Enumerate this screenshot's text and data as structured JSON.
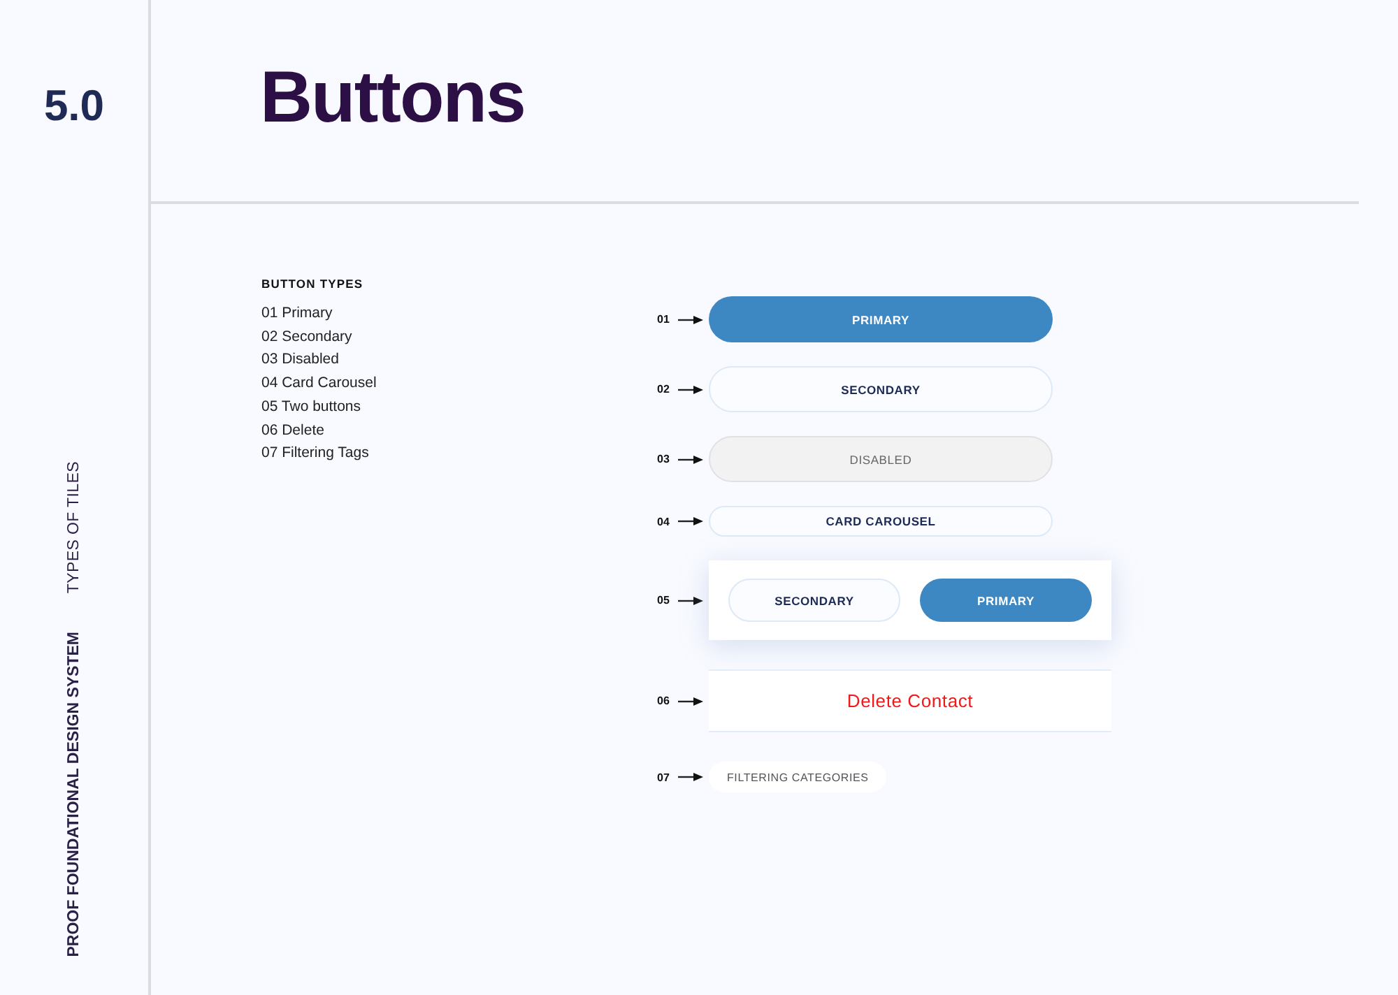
{
  "sidebar": {
    "section_number": "5.0",
    "subtitle": "TYPES OF TILES",
    "system_name": "PROOF FOUNDATIONAL DESIGN SYSTEM"
  },
  "page_title": "Buttons",
  "legend": {
    "heading": "BUTTON TYPES",
    "items": [
      "01 Primary",
      "02 Secondary",
      "03 Disabled",
      "04 Card Carousel",
      "05 Two buttons",
      "06 Delete",
      "07 Filtering Tags"
    ]
  },
  "examples": [
    {
      "number": "01",
      "kind": "primary",
      "label": "PRIMARY"
    },
    {
      "number": "02",
      "kind": "secondary",
      "label": "SECONDARY"
    },
    {
      "number": "03",
      "kind": "disabled",
      "label": "DISABLED"
    },
    {
      "number": "04",
      "kind": "carousel",
      "label": "CARD CAROUSEL"
    },
    {
      "number": "05",
      "kind": "pair",
      "buttons": [
        {
          "kind": "secondary",
          "label": "SECONDARY"
        },
        {
          "kind": "primary",
          "label": "PRIMARY"
        }
      ]
    },
    {
      "number": "06",
      "kind": "delete",
      "label": "Delete Contact"
    },
    {
      "number": "07",
      "kind": "tag",
      "label": "FILTERING CATEGORIES"
    }
  ]
}
